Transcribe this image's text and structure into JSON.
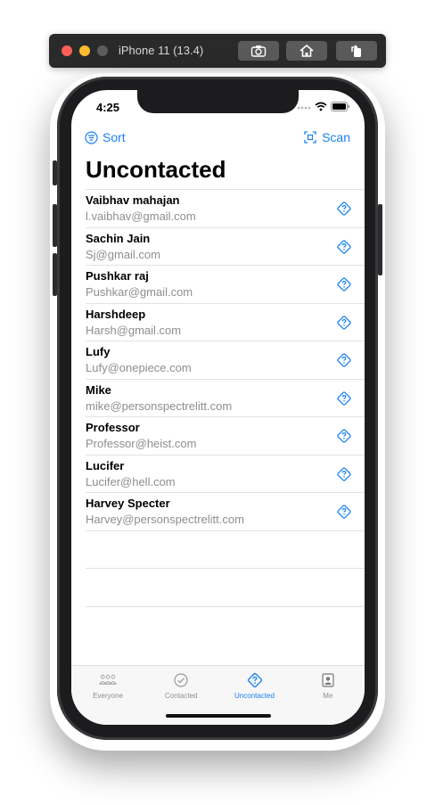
{
  "simulator": {
    "title": "iPhone 11 (13.4)"
  },
  "status_bar": {
    "time": "4:25"
  },
  "nav": {
    "sort_label": "Sort",
    "scan_label": "Scan"
  },
  "page_title": "Uncontacted",
  "contacts": [
    {
      "name": "Vaibhav mahajan",
      "email": "l.vaibhav@gmail.com"
    },
    {
      "name": "Sachin Jain",
      "email": "Sj@gmail.com"
    },
    {
      "name": "Pushkar raj",
      "email": "Pushkar@gmail.com"
    },
    {
      "name": "Harshdeep",
      "email": "Harsh@gmail.com"
    },
    {
      "name": "Lufy",
      "email": "Lufy@onepiece.com"
    },
    {
      "name": "Mike",
      "email": "mike@personspectrelitt.com"
    },
    {
      "name": "Professor",
      "email": "Professor@heist.com"
    },
    {
      "name": "Lucifer",
      "email": "Lucifer@hell.com"
    },
    {
      "name": "Harvey Specter",
      "email": "Harvey@personspectrelitt.com"
    }
  ],
  "tabs": [
    {
      "label": "Everyone",
      "icon": "people-icon",
      "active": false
    },
    {
      "label": "Contacted",
      "icon": "checkmark-circle-icon",
      "active": false
    },
    {
      "label": "Uncontacted",
      "icon": "question-diamond-icon",
      "active": true
    },
    {
      "label": "Me",
      "icon": "person-card-icon",
      "active": false
    }
  ],
  "colors": {
    "accent": "#1a82f0",
    "secondary_text": "#8e8e93"
  }
}
